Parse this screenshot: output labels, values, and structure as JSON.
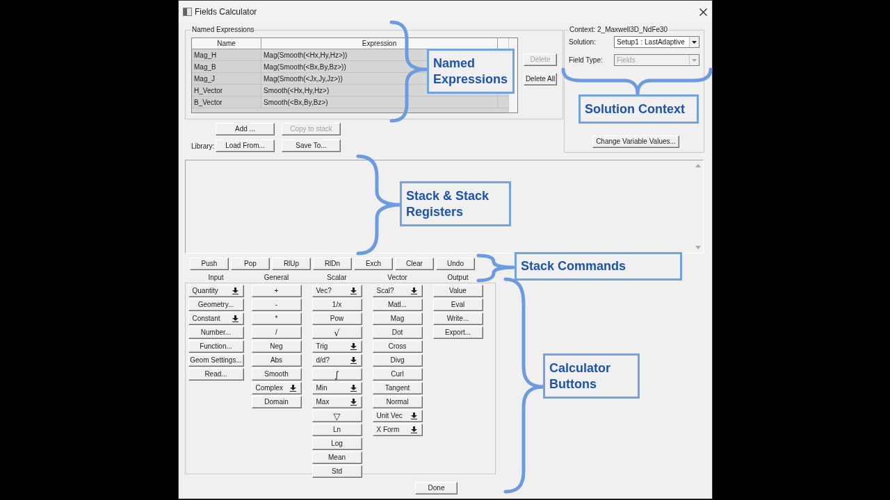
{
  "window": {
    "title": "Fields Calculator"
  },
  "named_expressions": {
    "title": "Named Expressions",
    "columns": [
      "Name",
      "Expression"
    ],
    "rows": [
      {
        "name": "Mag_H",
        "expression": "Mag(Smooth(<Hx,Hy,Hz>))"
      },
      {
        "name": "Mag_B",
        "expression": "Mag(Smooth(<Bx,By,Bz>))"
      },
      {
        "name": "Mag_J",
        "expression": "Mag(Smooth(<Jx,Jy,Jz>))"
      },
      {
        "name": "H_Vector",
        "expression": "Smooth(<Hx,Hy,Hz>)"
      },
      {
        "name": "B_Vector",
        "expression": "Smooth(<Bx,By,Bz>)"
      }
    ],
    "side_buttons": [
      {
        "label": "Delete",
        "disabled": true
      },
      {
        "label": "Delete All",
        "disabled": false
      }
    ],
    "buttons": [
      {
        "label": "Add ...",
        "disabled": false
      },
      {
        "label": "Copy to stack",
        "disabled": true
      }
    ]
  },
  "library": {
    "label": "Library:",
    "buttons": [
      {
        "label": "Load From...",
        "disabled": false
      },
      {
        "label": "Save To...",
        "disabled": false
      }
    ]
  },
  "context": {
    "title": "Context: 2_Maxwell3D_NdFe30",
    "fields": [
      {
        "label": "Solution:",
        "value": "Setup1 : LastAdaptive",
        "disabled": false
      },
      {
        "label": "Field Type:",
        "value": "Fields",
        "disabled": true
      }
    ],
    "button": "Change Variable Values..."
  },
  "stack_commands": [
    "Push",
    "Pop",
    "RlUp",
    "RlDn",
    "Exch",
    "Clear",
    "Undo"
  ],
  "calculator": {
    "columns": [
      {
        "title": "Input",
        "buttons": [
          {
            "label": "Quantity",
            "kind": "menu"
          },
          {
            "label": "Geometry...",
            "kind": "plain"
          },
          {
            "label": "Constant",
            "kind": "menu"
          },
          {
            "label": "Number...",
            "kind": "plain"
          },
          {
            "label": "Function...",
            "kind": "plain"
          },
          {
            "label": "Geom Settings...",
            "kind": "plain"
          },
          {
            "label": "Read...",
            "kind": "plain"
          }
        ]
      },
      {
        "title": "General",
        "buttons": [
          {
            "label": "+",
            "kind": "plain"
          },
          {
            "label": "-",
            "kind": "plain"
          },
          {
            "label": "*",
            "kind": "plain"
          },
          {
            "label": "/",
            "kind": "plain"
          },
          {
            "label": "Neg",
            "kind": "plain"
          },
          {
            "label": "Abs",
            "kind": "plain"
          },
          {
            "label": "Smooth",
            "kind": "plain"
          },
          {
            "label": "Complex",
            "kind": "menu"
          },
          {
            "label": "Domain",
            "kind": "plain"
          }
        ]
      },
      {
        "title": "Scalar",
        "buttons": [
          {
            "label": "Vec?",
            "kind": "menu"
          },
          {
            "label": "1/x",
            "kind": "plain"
          },
          {
            "label": "Pow",
            "kind": "plain"
          },
          {
            "label": "√",
            "kind": "symbol"
          },
          {
            "label": "Trig",
            "kind": "menu"
          },
          {
            "label": "d/d?",
            "kind": "menu"
          },
          {
            "label": "∫",
            "kind": "symbol"
          },
          {
            "label": "Min",
            "kind": "menu"
          },
          {
            "label": "Max",
            "kind": "menu"
          },
          {
            "label": "▽",
            "kind": "symbol"
          },
          {
            "label": "Ln",
            "kind": "plain"
          },
          {
            "label": "Log",
            "kind": "plain"
          },
          {
            "label": "Mean",
            "kind": "plain"
          },
          {
            "label": "Std",
            "kind": "plain"
          }
        ]
      },
      {
        "title": "Vector",
        "buttons": [
          {
            "label": "Scal?",
            "kind": "menu"
          },
          {
            "label": "Matl...",
            "kind": "plain"
          },
          {
            "label": "Mag",
            "kind": "plain"
          },
          {
            "label": "Dot",
            "kind": "plain"
          },
          {
            "label": "Cross",
            "kind": "plain"
          },
          {
            "label": "Divg",
            "kind": "plain"
          },
          {
            "label": "Curl",
            "kind": "plain"
          },
          {
            "label": "Tangent",
            "kind": "plain"
          },
          {
            "label": "Normal",
            "kind": "plain"
          },
          {
            "label": "Unit Vec",
            "kind": "menu"
          },
          {
            "label": "X Form",
            "kind": "menu"
          }
        ]
      },
      {
        "title": "Output",
        "buttons": [
          {
            "label": "Value",
            "kind": "plain"
          },
          {
            "label": "Eval",
            "kind": "plain"
          },
          {
            "label": "Write...",
            "kind": "plain"
          },
          {
            "label": "Export...",
            "kind": "plain"
          }
        ]
      }
    ]
  },
  "done_button": "Done",
  "annotations": [
    {
      "text": "Named Expressions"
    },
    {
      "text": "Solution Context"
    },
    {
      "text": "Stack & Stack Registers"
    },
    {
      "text": "Stack Commands"
    },
    {
      "text": "Calculator Buttons"
    }
  ]
}
